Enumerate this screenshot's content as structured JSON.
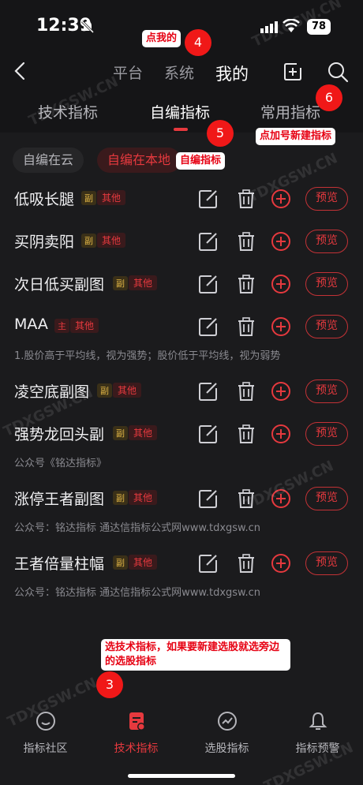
{
  "status": {
    "time": "12:39",
    "battery": "78"
  },
  "header": {
    "tabs": [
      {
        "label": "平台"
      },
      {
        "label": "系统"
      },
      {
        "label": "我的"
      }
    ],
    "subtabs": [
      {
        "label": "技术指标"
      },
      {
        "label": "自编指标"
      },
      {
        "label": "常用指标"
      }
    ]
  },
  "chips": {
    "cloud": "自编在云",
    "local": "自编在本地"
  },
  "rows": [
    {
      "name": "低吸长腿",
      "type": "副",
      "category": "其他",
      "preview": "预览"
    },
    {
      "name": "买阴卖阳",
      "type": "副",
      "category": "其他",
      "preview": "预览"
    },
    {
      "name": "次日低买副图",
      "type": "副",
      "category": "其他",
      "preview": "预览"
    },
    {
      "name": "MAA",
      "type": "主",
      "category": "其他",
      "preview": "预览",
      "desc": "1.股价高于平均线，视为强势；股价低于平均线，视为弱势"
    },
    {
      "name": "凌空底副图",
      "type": "副",
      "category": "其他",
      "preview": "预览"
    },
    {
      "name": "强势龙回头副",
      "type": "副",
      "category": "其他",
      "preview": "预览",
      "desc": "公众号《铭达指标》"
    },
    {
      "name": "涨停王者副图",
      "type": "副",
      "category": "其他",
      "preview": "预览",
      "desc": "公众号：铭达指标  通达信指标公式网www.tdxgsw.cn"
    },
    {
      "name": "王者倍量柱幅",
      "type": "副",
      "category": "其他",
      "preview": "预览",
      "desc": "公众号：铭达指标  通达信指标公式网www.tdxgsw.cn"
    }
  ],
  "annotations": {
    "tap_mine": "点我的",
    "tap_plus": "点加号新建指标",
    "custom": "自编指标",
    "tech_note": "选技术指标，如果要新建选股就选旁边的选股指标",
    "n3": "3",
    "n4": "4",
    "n5": "5",
    "n6": "6"
  },
  "bottom_nav": [
    {
      "label": "指标社区",
      "icon": "chat-icon"
    },
    {
      "label": "技术指标",
      "icon": "document-icon"
    },
    {
      "label": "选股指标",
      "icon": "trend-icon"
    },
    {
      "label": "指标预警",
      "icon": "bell-icon"
    }
  ],
  "watermark": "TDXGSW.CN",
  "colors": {
    "accent": "#e6393e",
    "tag_fu": "#e2b646",
    "background": "#1b1b1d"
  }
}
